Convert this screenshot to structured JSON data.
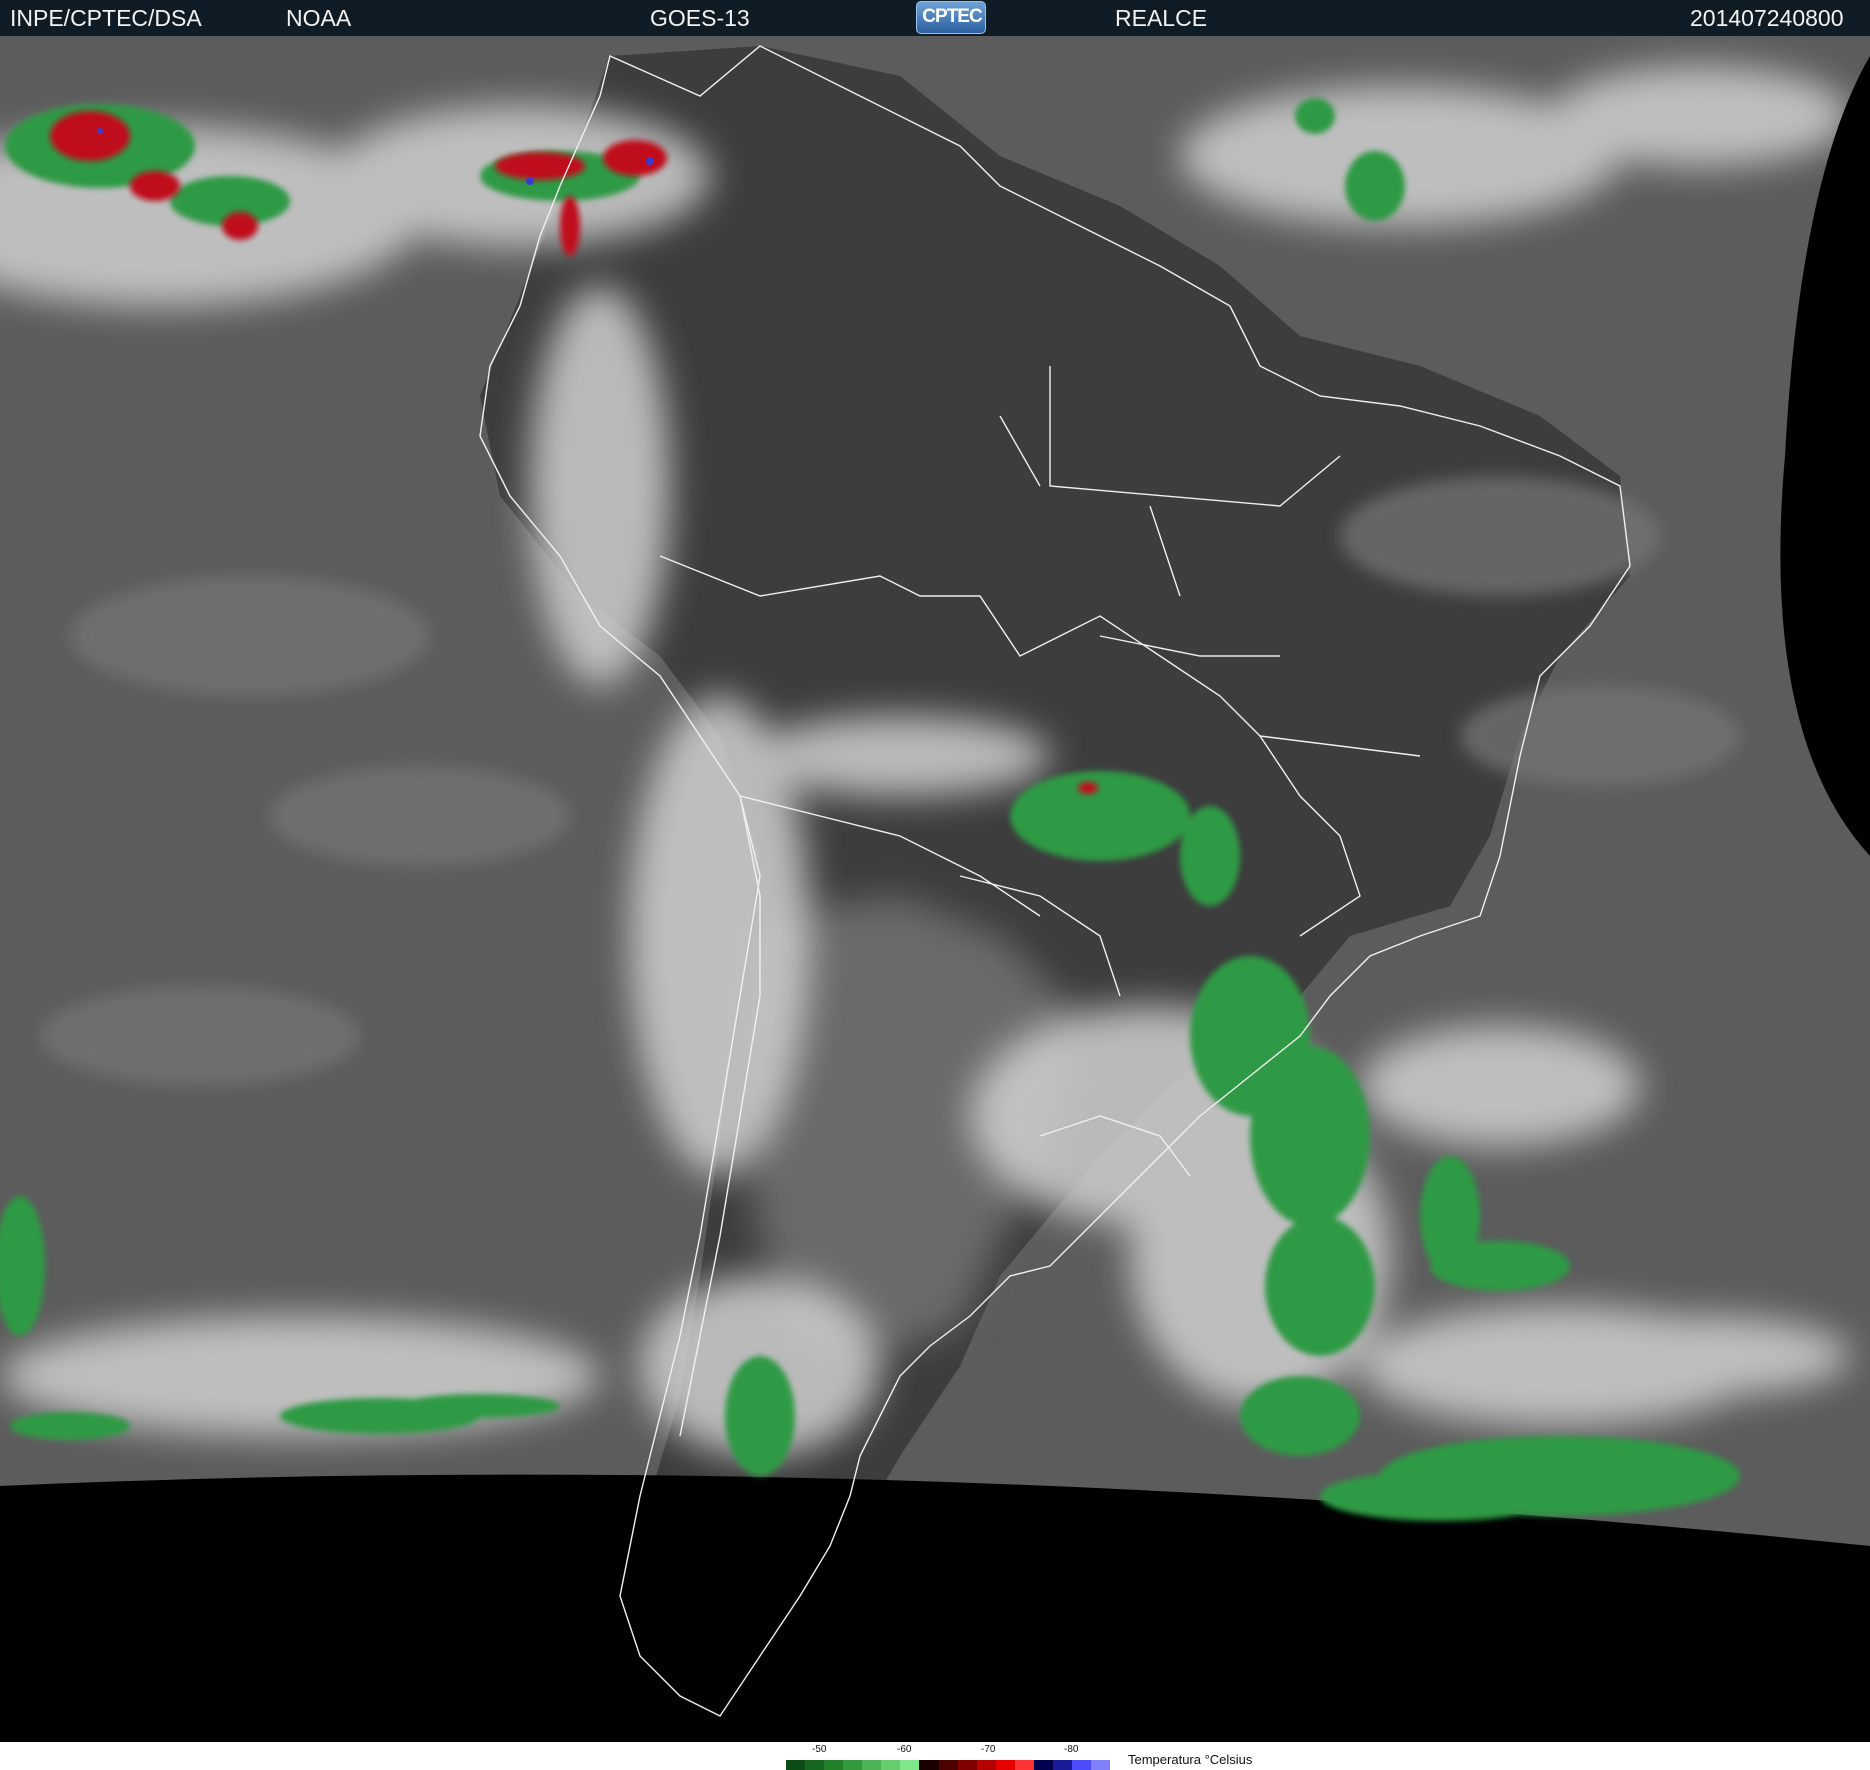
{
  "header": {
    "source": "INPE/CPTEC/DSA",
    "agency": "NOAA",
    "satellite": "GOES-13",
    "logo_text": "CPTEC",
    "product": "REALCE",
    "timestamp": "201407240800"
  },
  "map": {
    "icons": [
      "cloud-top-cluster",
      "coastline",
      "border"
    ],
    "colors": {
      "ocean_gray": "#5b5b5b",
      "land_dark": "#3a3a3a",
      "cloud_white": "#d9d9d9",
      "space_black": "#000000",
      "cold_green": "#2f9a45",
      "very_cold_red": "#c0101a",
      "coldest_blue": "#3a3ad0"
    }
  },
  "legend": {
    "ticks": [
      "-50",
      "-60",
      "-70",
      "-80"
    ],
    "title": "Temperatura °Celsius",
    "colors": [
      "#0b4d14",
      "#17661f",
      "#23802b",
      "#34993c",
      "#4db255",
      "#66cc6e",
      "#80e68a",
      "#1a0000",
      "#4d0000",
      "#800000",
      "#b30000",
      "#e60000",
      "#ff3333",
      "#00004d",
      "#1a1a99",
      "#4d4dff",
      "#8080ff"
    ]
  }
}
